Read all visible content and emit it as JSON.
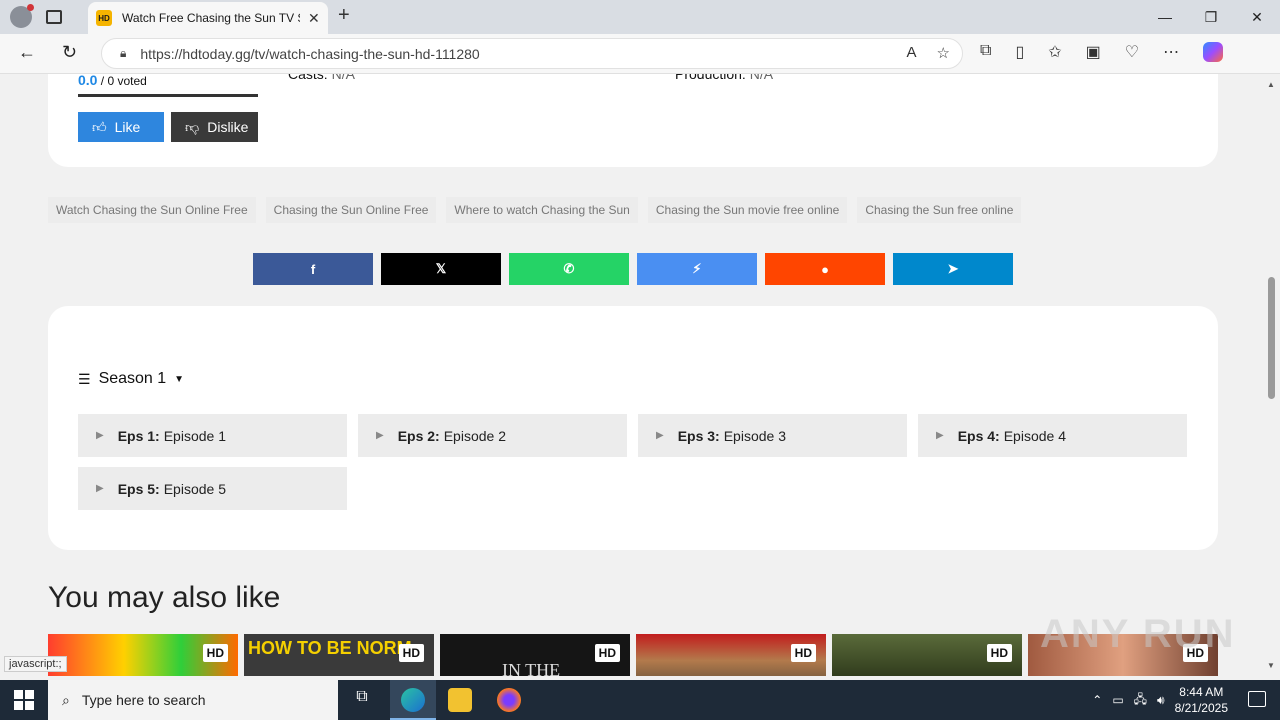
{
  "browser": {
    "tab_title": "Watch Free Chasing the Sun TV Sh",
    "favicon_text": "HD",
    "url": "https://hdtoday.gg/tv/watch-chasing-the-sun-hd-111280"
  },
  "detail": {
    "rating_value": "0.0",
    "rating_votes": " / 0 voted",
    "casts_label": "Casts: ",
    "casts_value": "N/A",
    "production_label": "Production: ",
    "production_value": "N/A",
    "like_label": "Like",
    "dislike_label": "Dislike"
  },
  "tags": [
    "Watch Chasing the Sun Online Free",
    "Chasing the Sun Online Free",
    "Where to watch Chasing the Sun",
    "Chasing the Sun movie free online",
    "Chasing the Sun free online"
  ],
  "share": {
    "colors": [
      "#3b5998",
      "#000000",
      "#25d366",
      "#4a8ff2",
      "#ff4500",
      "#0088cc"
    ],
    "icons": [
      "facebook-icon",
      "x-icon",
      "whatsapp-icon",
      "messenger-icon",
      "reddit-icon",
      "telegram-icon"
    ]
  },
  "season": {
    "label": "Season 1"
  },
  "episodes": [
    {
      "num": "Eps 1:",
      "title": " Episode 1"
    },
    {
      "num": "Eps 2:",
      "title": " Episode 2"
    },
    {
      "num": "Eps 3:",
      "title": " Episode 3"
    },
    {
      "num": "Eps 4:",
      "title": " Episode 4"
    },
    {
      "num": "Eps 5:",
      "title": " Episode 5"
    }
  ],
  "also_like": {
    "heading": "You may also like",
    "badge": "HD",
    "poster2_text": "HOW TO BE NORM",
    "poster3_text": "IN THE"
  },
  "status_text": "javascript:;",
  "watermark": "ANY RUN",
  "taskbar": {
    "search_placeholder": "Type here to search",
    "time": "8:44 AM",
    "date": "8/21/2025"
  }
}
